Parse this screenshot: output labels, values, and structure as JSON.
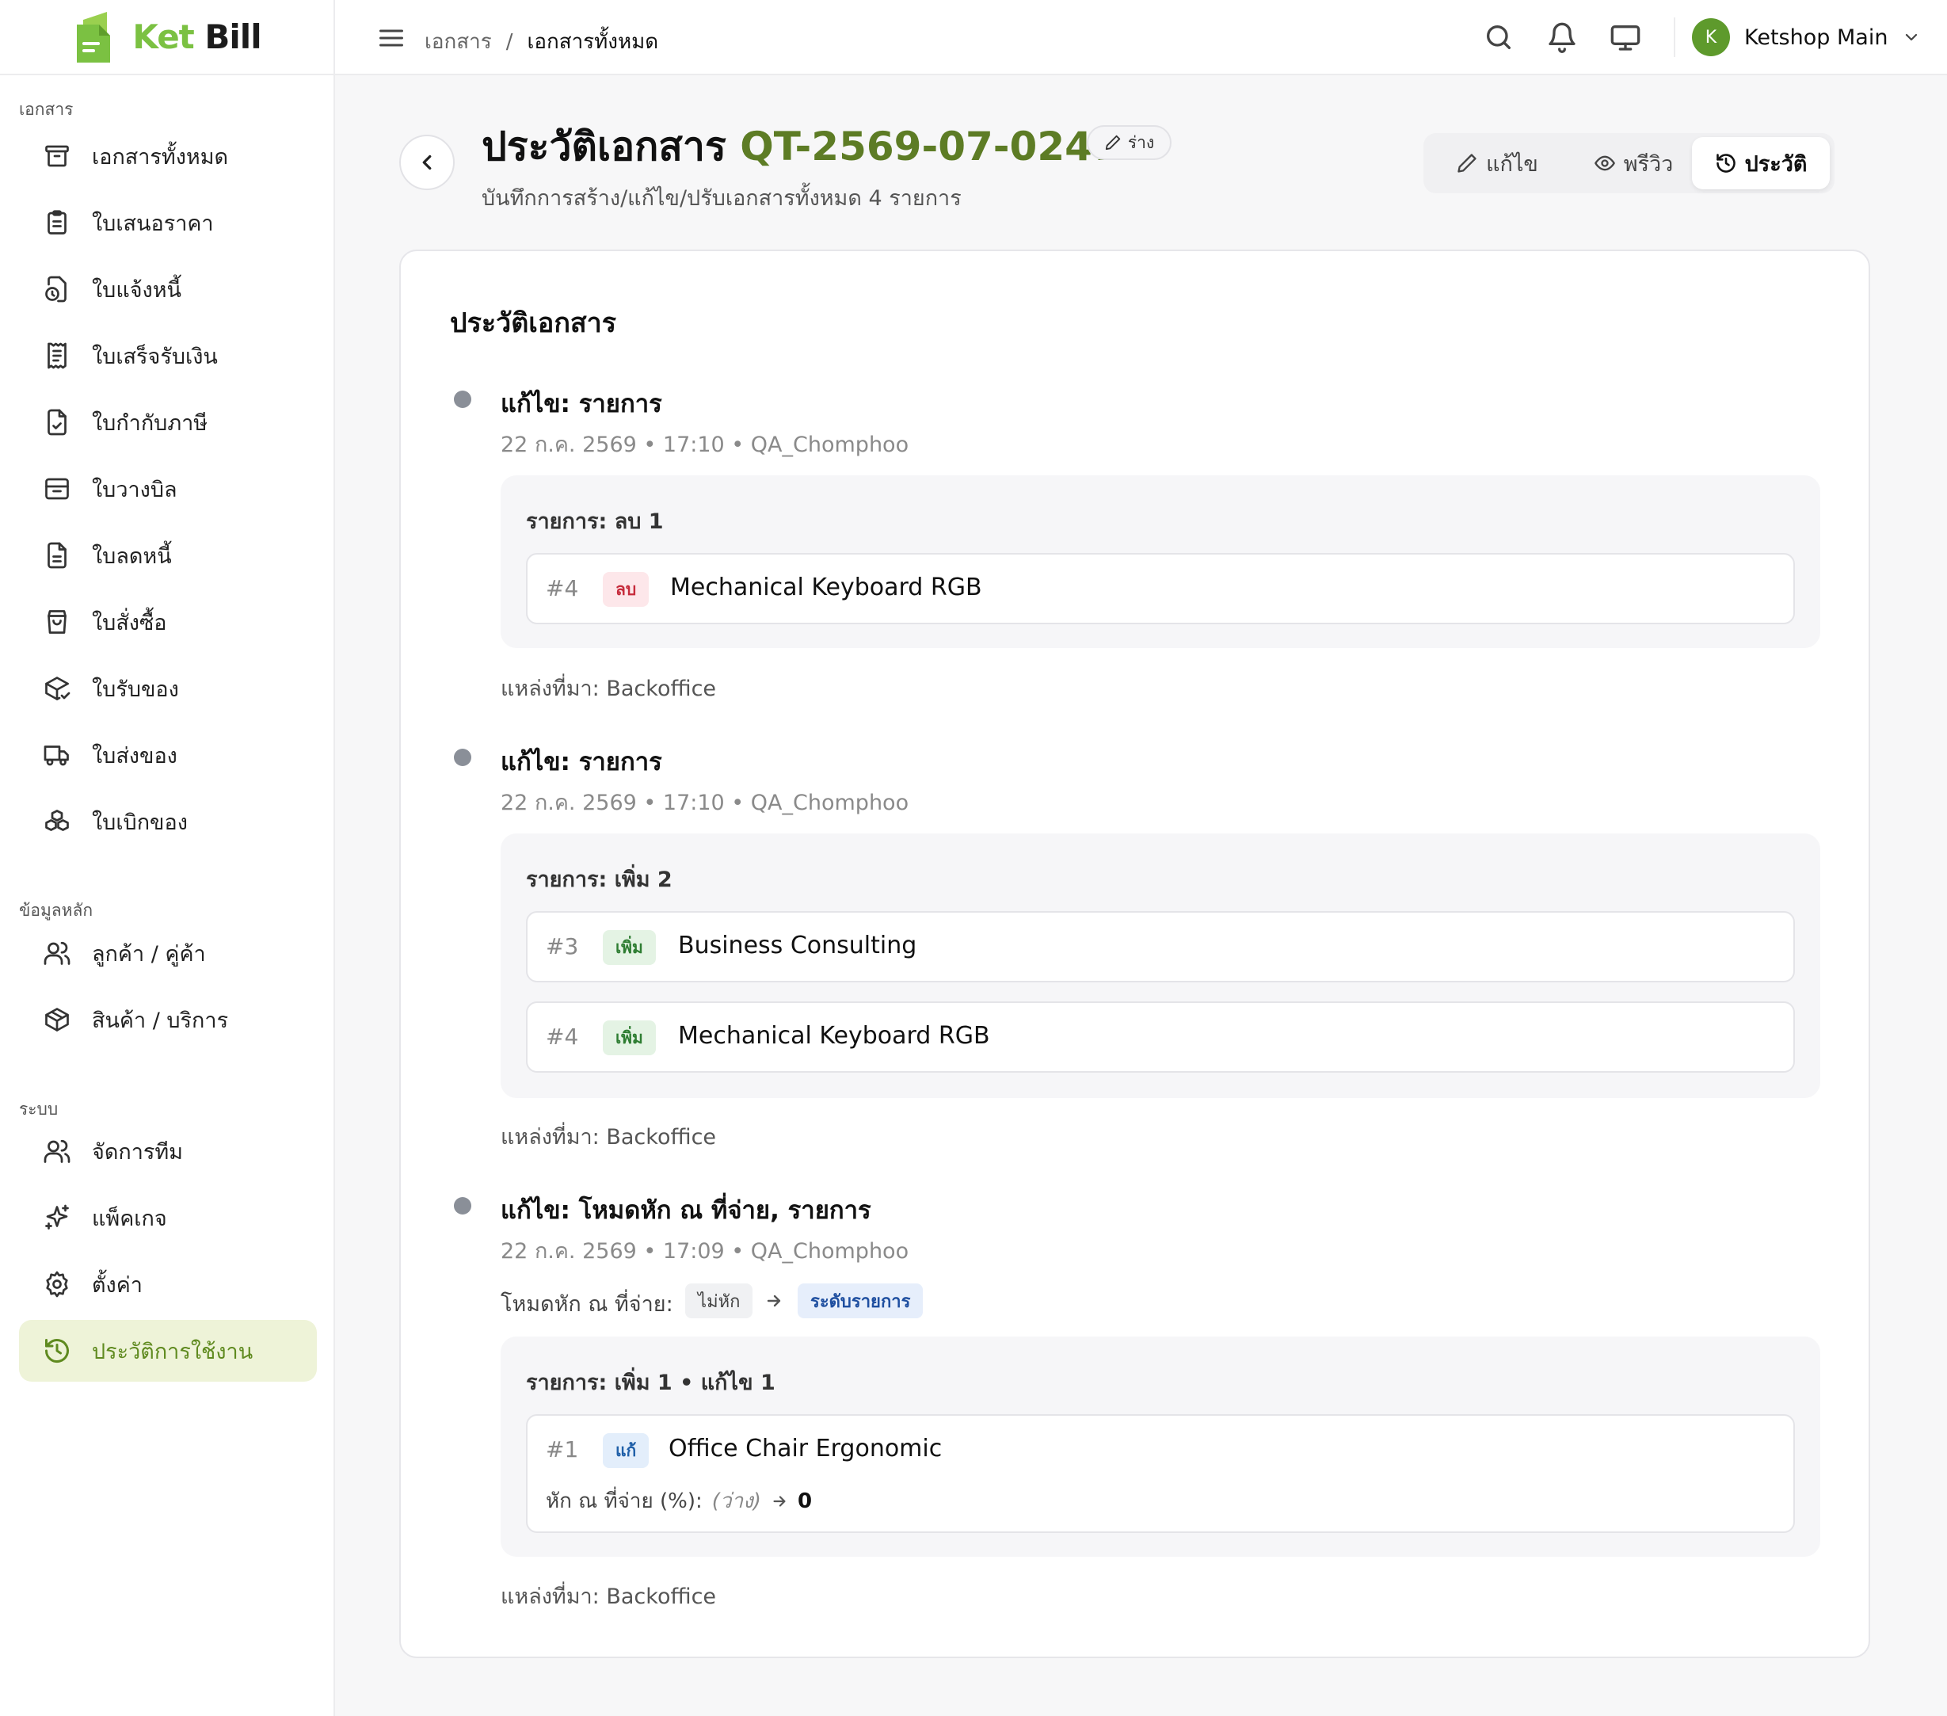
{
  "app": {
    "brand_part1": "Ket",
    "brand_part2": "Bill"
  },
  "sidebar": {
    "sections": [
      {
        "title": "เอกสาร"
      },
      {
        "title": "ข้อมูลหลัก"
      },
      {
        "title": "ระบบ"
      }
    ],
    "items": [
      {
        "label": "เอกสารทั้งหมด",
        "icon": "archive-icon"
      },
      {
        "label": "ใบเสนอราคา",
        "icon": "clipboard-icon"
      },
      {
        "label": "ใบแจ้งหนี้",
        "icon": "file-clock-icon"
      },
      {
        "label": "ใบเสร็จรับเงิน",
        "icon": "receipt-icon"
      },
      {
        "label": "ใบกำกับภาษี",
        "icon": "file-check-icon"
      },
      {
        "label": "ใบวางบิล",
        "icon": "inbox-icon"
      },
      {
        "label": "ใบลดหนี้",
        "icon": "file-text-icon"
      },
      {
        "label": "ใบสั่งซื้อ",
        "icon": "shopping-bag-icon"
      },
      {
        "label": "ใบรับของ",
        "icon": "package-check-icon"
      },
      {
        "label": "ใบส่งของ",
        "icon": "truck-icon"
      },
      {
        "label": "ใบเบิกของ",
        "icon": "boxes-icon"
      },
      {
        "label": "ลูกค้า / คู่ค้า",
        "icon": "users-icon"
      },
      {
        "label": "สินค้า / บริการ",
        "icon": "package-icon"
      },
      {
        "label": "จัดการทีม",
        "icon": "team-icon"
      },
      {
        "label": "แพ็คเกจ",
        "icon": "sparkles-icon"
      },
      {
        "label": "ตั้งค่า",
        "icon": "gear-icon"
      },
      {
        "label": "ประวัติการใช้งาน",
        "icon": "history-icon"
      }
    ]
  },
  "topbar": {
    "breadcrumb_root": "เอกสาร",
    "breadcrumb_sep": "/",
    "breadcrumb_current": "เอกสารทั้งหมด",
    "avatar_initial": "K",
    "workspace_name": "Ketshop Main"
  },
  "header": {
    "title_prefix": "ประวัติเอกสาร",
    "doc_code": "QT-2569-07-0247",
    "status_label": "ร่าง",
    "subtitle": "บันทึกการสร้าง/แก้ไข/ปรับเอกสารทั้งหมด 4 รายการ",
    "tabs": [
      {
        "label": "แก้ไข"
      },
      {
        "label": "พรีวิว"
      },
      {
        "label": "ประวัติ"
      }
    ]
  },
  "history": {
    "card_title": "ประวัติเอกสาร",
    "events": [
      {
        "title": "แก้ไข: รายการ",
        "meta": "22 ก.ค. 2569 • 17:10 • QA_Chomphoo",
        "box_title": "รายการ: ลบ 1",
        "rows": [
          {
            "num": "#4",
            "tag": "ลบ",
            "name": "Mechanical Keyboard RGB"
          }
        ],
        "source": "แหล่งที่มา: Backoffice"
      },
      {
        "title": "แก้ไข: รายการ",
        "meta": "22 ก.ค. 2569 • 17:10 • QA_Chomphoo",
        "box_title": "รายการ: เพิ่ม 2",
        "rows": [
          {
            "num": "#3",
            "tag": "เพิ่ม",
            "name": "Business Consulting"
          },
          {
            "num": "#4",
            "tag": "เพิ่ม",
            "name": "Mechanical Keyboard RGB"
          }
        ],
        "source": "แหล่งที่มา: Backoffice"
      },
      {
        "title": "แก้ไข: โหมดหัก ณ ที่จ่าย, รายการ",
        "meta": "22 ก.ค. 2569 • 17:09 • QA_Chomphoo",
        "field_label": "โหมดหัก ณ ที่จ่าย:",
        "field_from": "ไม่หัก",
        "field_to": "ระดับรายการ",
        "box_title": "รายการ: เพิ่ม 1 • แก้ไข 1",
        "rows": [
          {
            "num": "#1",
            "tag": "แก้",
            "name": "Office Chair Ergonomic",
            "detail_label": "หัก ณ ที่จ่าย (%):",
            "detail_from": "(ว่าง)",
            "detail_to": "0"
          }
        ],
        "source": "แหล่งที่มา: Backoffice"
      }
    ]
  },
  "colors": {
    "brand_green": "#7bc142",
    "accent_green": "#5d7c25",
    "active_bg": "#eef3d8"
  }
}
